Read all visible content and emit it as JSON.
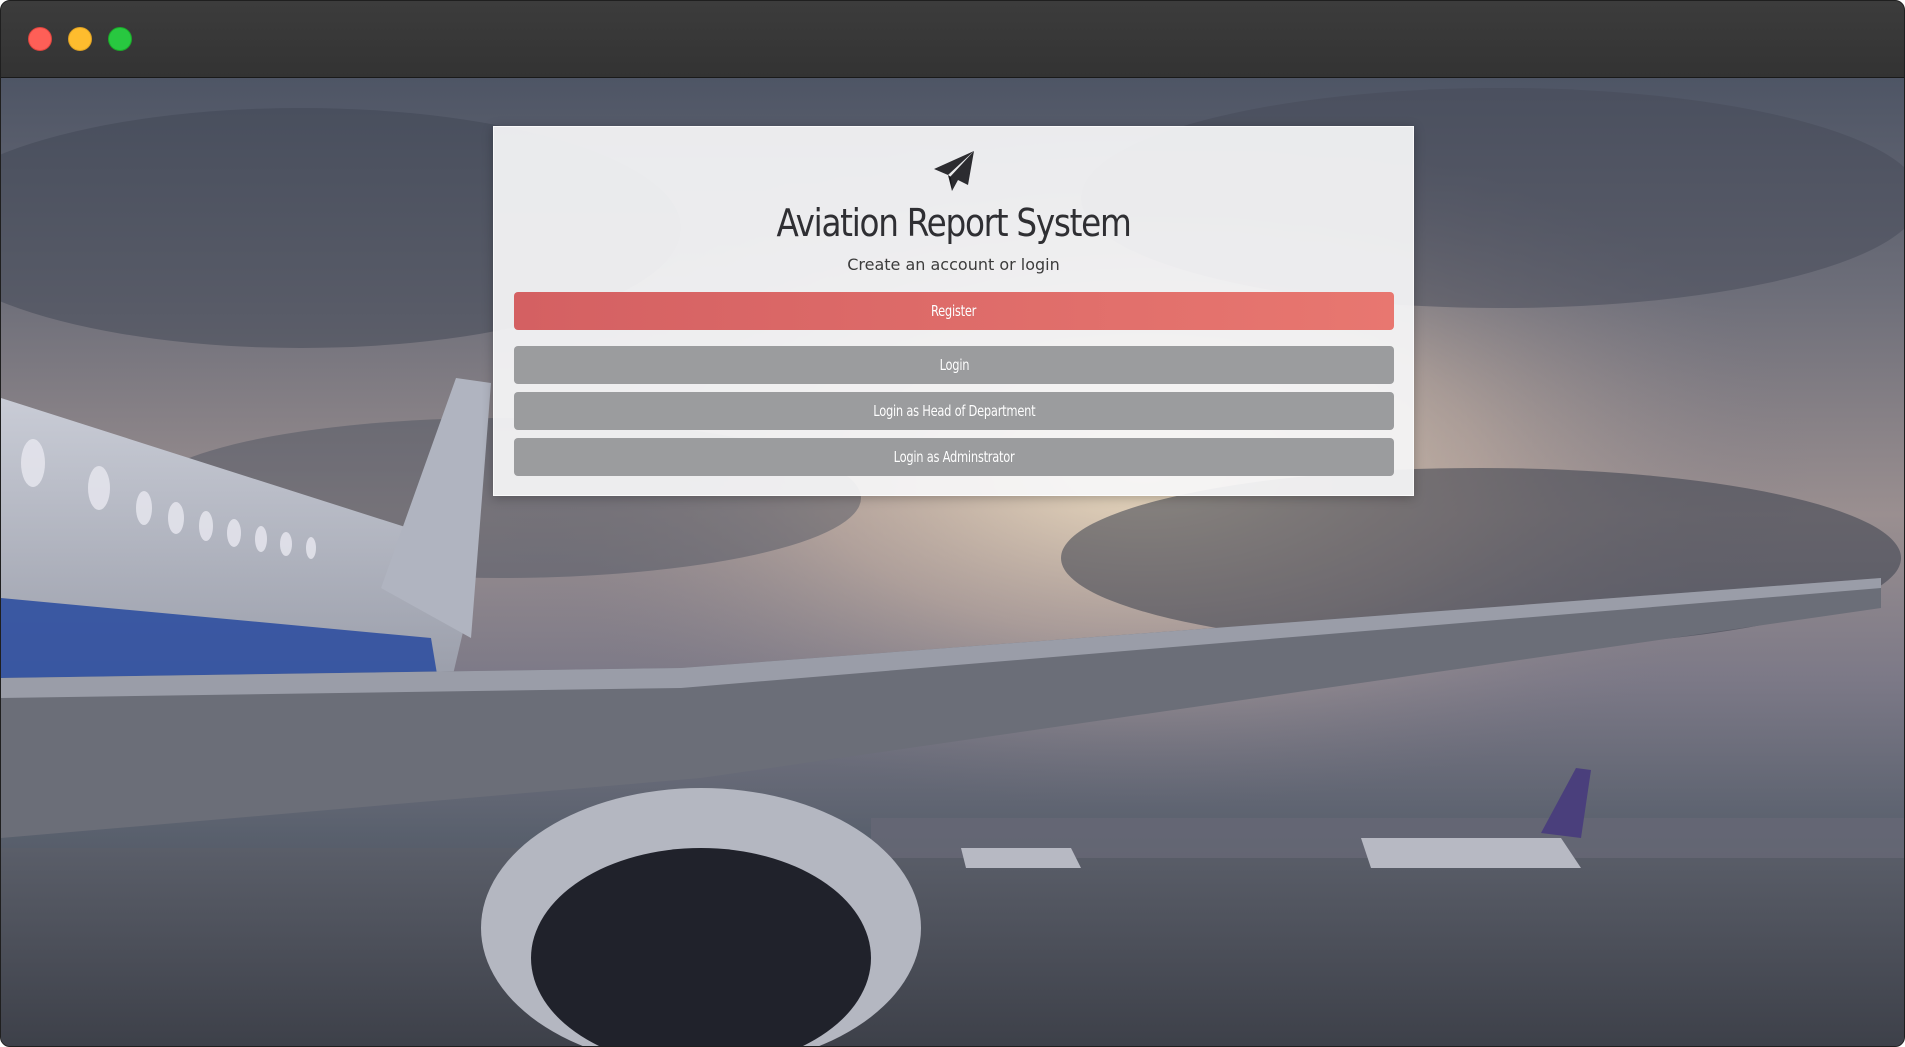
{
  "window": {
    "controls": [
      "close",
      "minimize",
      "maximize"
    ]
  },
  "app": {
    "logo_icon": "paper-plane-icon",
    "title": "Aviation Report System",
    "subtitle": "Create an account or login"
  },
  "buttons": {
    "register": "Register",
    "login": "Login",
    "login_hod": "Login as Head of Department",
    "login_admin": "Login as Adminstrator"
  },
  "colors": {
    "register": "#e06a69",
    "secondary": "#9b9c9e",
    "card": "#f6f6f8"
  }
}
